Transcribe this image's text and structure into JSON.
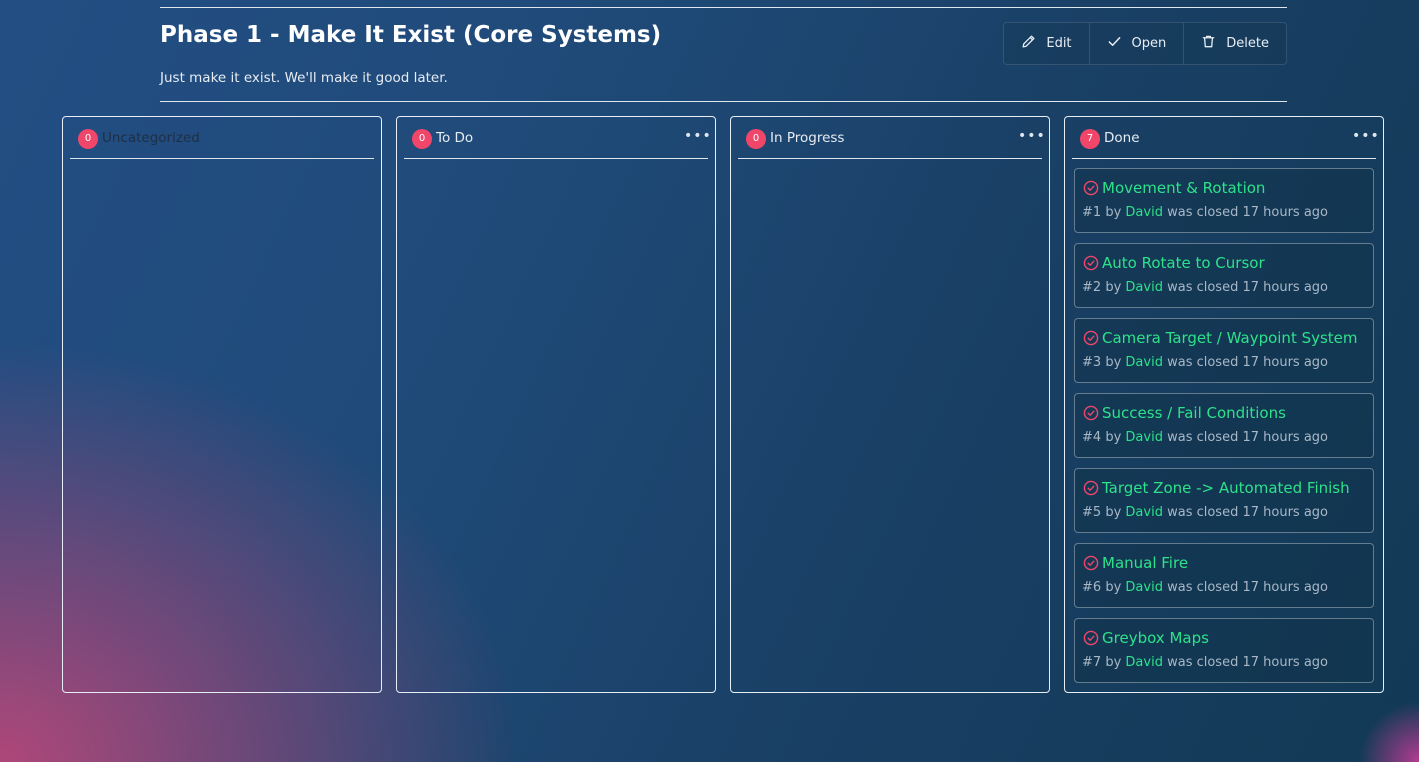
{
  "header": {
    "title": "Phase 1 - Make It Exist (Core Systems)",
    "description": "Just make it exist. We'll make it good later.",
    "actions": [
      {
        "label": "Edit",
        "icon": "pencil-icon"
      },
      {
        "label": "Open",
        "icon": "check-icon"
      },
      {
        "label": "Delete",
        "icon": "trash-icon"
      }
    ]
  },
  "colors": {
    "badge": "#f0466a",
    "accent_green": "#2de28a",
    "closed_icon": "#f0466a"
  },
  "columns": [
    {
      "title": "Uncategorized",
      "count": "0",
      "has_menu": false,
      "cards": []
    },
    {
      "title": "To Do",
      "count": "0",
      "has_menu": true,
      "cards": []
    },
    {
      "title": "In Progress",
      "count": "0",
      "has_menu": true,
      "cards": []
    },
    {
      "title": "Done",
      "count": "7",
      "has_menu": true,
      "cards": [
        {
          "title": "Movement & Rotation",
          "number": "#1",
          "by": "by",
          "author": "David",
          "status": "was closed 17 hours ago"
        },
        {
          "title": "Auto Rotate to Cursor",
          "number": "#2",
          "by": "by",
          "author": "David",
          "status": "was closed 17 hours ago"
        },
        {
          "title": "Camera Target / Waypoint System",
          "number": "#3",
          "by": "by",
          "author": "David",
          "status": "was closed 17 hours ago"
        },
        {
          "title": "Success / Fail Conditions",
          "number": "#4",
          "by": "by",
          "author": "David",
          "status": "was closed 17 hours ago"
        },
        {
          "title": "Target Zone -> Automated Finish",
          "number": "#5",
          "by": "by",
          "author": "David",
          "status": "was closed 17 hours ago"
        },
        {
          "title": "Manual Fire",
          "number": "#6",
          "by": "by",
          "author": "David",
          "status": "was closed 17 hours ago"
        },
        {
          "title": "Greybox Maps",
          "number": "#7",
          "by": "by",
          "author": "David",
          "status": "was closed 17 hours ago"
        }
      ]
    }
  ]
}
